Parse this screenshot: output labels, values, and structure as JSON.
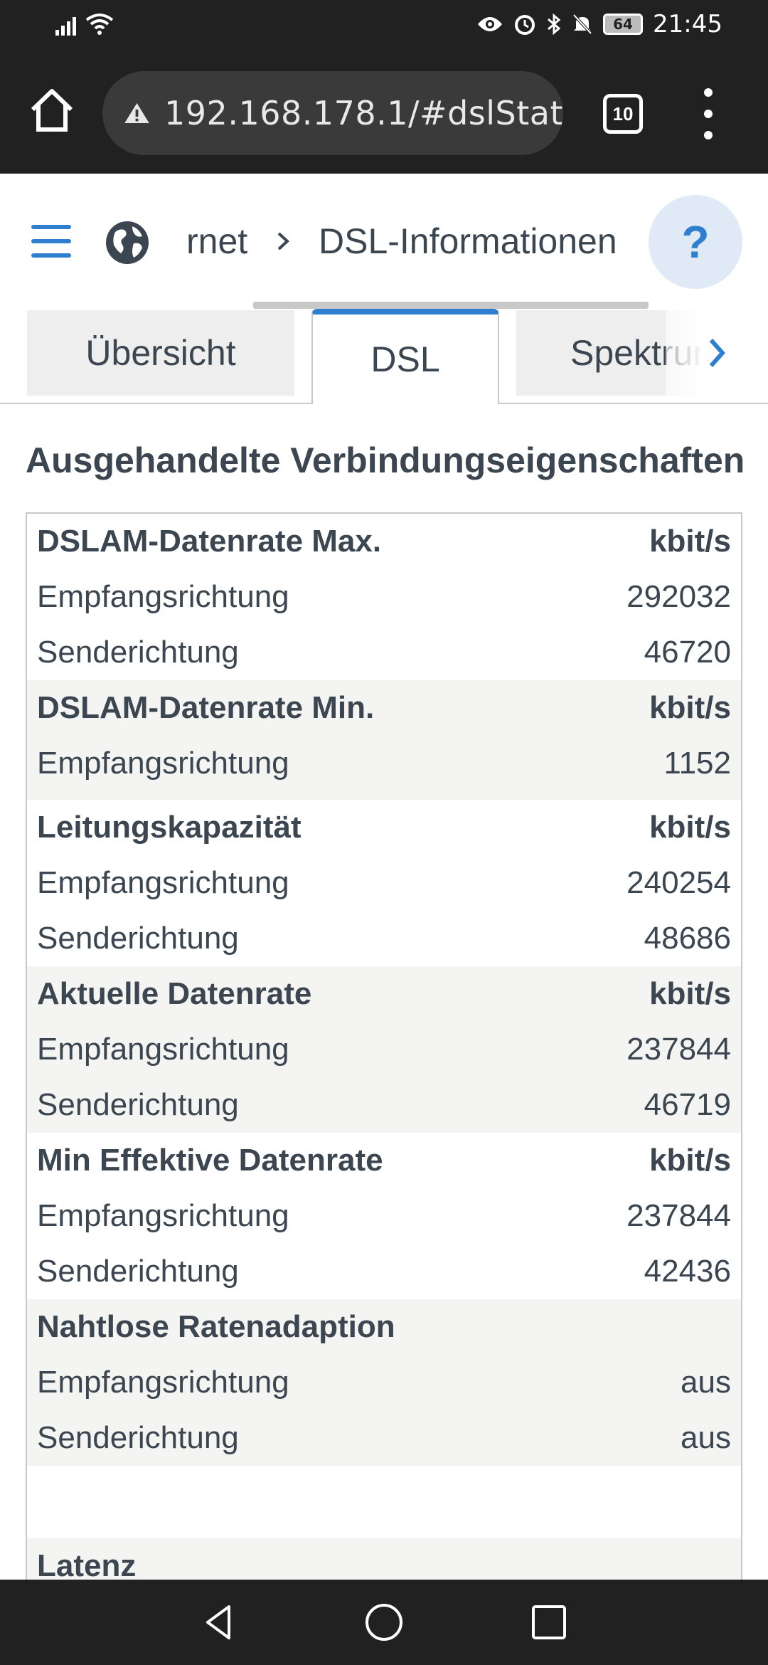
{
  "status_bar": {
    "time": "21:45",
    "battery": "64",
    "icons": [
      "signal-icon",
      "wifi-icon",
      "eye-icon",
      "alarm-icon",
      "bluetooth-icon",
      "mute-icon",
      "battery-icon"
    ]
  },
  "browser": {
    "url": "192.168.178.1/#dslStat",
    "tab_count": "10"
  },
  "header": {
    "breadcrumb_1": "rnet",
    "breadcrumb_2": "DSL-Informationen",
    "help": "?"
  },
  "tabs": [
    {
      "label": "Übersicht"
    },
    {
      "label": "DSL"
    },
    {
      "label": "Spektrum"
    }
  ],
  "section": {
    "title": "Ausgehandelte Verbindungseigenschaften"
  },
  "table": {
    "groups": [
      {
        "header": "DSLAM-Datenrate Max.",
        "unit": "kbit/s",
        "rows": [
          {
            "label": "Empfangsrichtung",
            "value": "292032"
          },
          {
            "label": "Senderichtung",
            "value": "46720"
          }
        ]
      },
      {
        "header": "DSLAM-Datenrate Min.",
        "unit": "kbit/s",
        "rows": [
          {
            "label": "Empfangsrichtung",
            "value": "1152"
          }
        ]
      },
      {
        "header": "Leitungskapazität",
        "unit": "kbit/s",
        "rows": [
          {
            "label": "Empfangsrichtung",
            "value": "240254"
          },
          {
            "label": "Senderichtung",
            "value": "48686"
          }
        ]
      },
      {
        "header": "Aktuelle Datenrate",
        "unit": "kbit/s",
        "rows": [
          {
            "label": "Empfangsrichtung",
            "value": "237844"
          },
          {
            "label": "Senderichtung",
            "value": "46719"
          }
        ]
      },
      {
        "header": "Min Effektive Datenrate",
        "unit": "kbit/s",
        "rows": [
          {
            "label": "Empfangsrichtung",
            "value": "237844"
          },
          {
            "label": "Senderichtung",
            "value": "42436"
          }
        ]
      },
      {
        "header": "Nahtlose Ratenadaption",
        "unit": "",
        "rows": [
          {
            "label": "Empfangsrichtung",
            "value": "aus"
          },
          {
            "label": "Senderichtung",
            "value": "aus"
          }
        ]
      },
      {
        "header": "Latenz",
        "unit": "",
        "rows": []
      }
    ]
  },
  "colors": {
    "accent": "#2f7fd1",
    "chrome": "#212121",
    "text": "#3c4650",
    "row_shade": "#f4f4f2"
  }
}
